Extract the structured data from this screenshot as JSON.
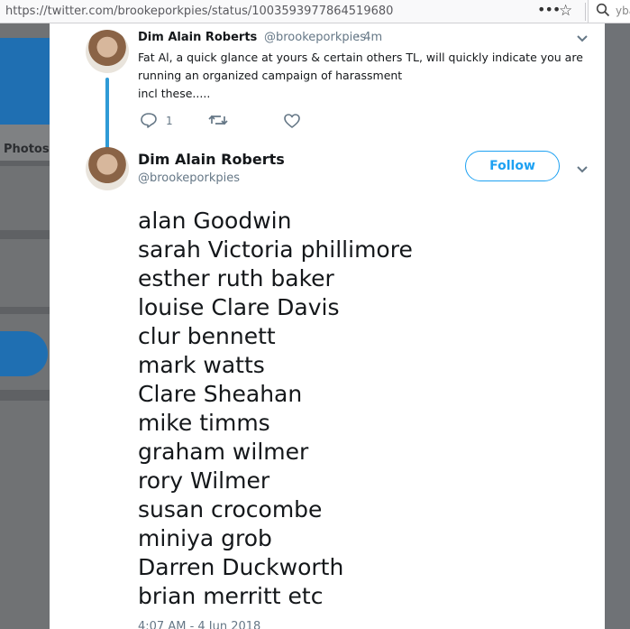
{
  "browser": {
    "url": "https://twitter.com/brookeporkpies/status/1003593977864519680",
    "menu_icon": "ellipsis-icon",
    "bookmark_icon": "star-icon",
    "search_text": "yba"
  },
  "background": {
    "tab_label": "Photos"
  },
  "reply_tweet": {
    "name": "Dim Alain Roberts",
    "handle": "@brookeporkpies",
    "time": "· 4m",
    "text_line1": "Fat Al, a quick glance at yours & certain others TL, will quickly indicate you are",
    "text_line2": "running an organized campaign of harassment",
    "text_line3": "incl these.....",
    "reply_count": "1"
  },
  "main_tweet": {
    "name": "Dim Alain Roberts",
    "handle": "@brookeporkpies",
    "follow_label": "Follow",
    "names": [
      "alan Goodwin",
      "sarah Victoria phillimore",
      "esther ruth baker",
      "louise Clare Davis",
      "clur bennett",
      "mark watts",
      "Clare Sheahan",
      "mike timms",
      "graham wilmer",
      "rory Wilmer",
      "susan crocombe",
      "miniya grob",
      "Darren Duckworth",
      "brian merritt etc"
    ],
    "timestamp": "4:07 AM - 4 Jun 2018"
  },
  "colors": {
    "accent": "#1da1f2",
    "thread_line": "#2f9bd6",
    "muted": "#657786",
    "text": "#14171a",
    "overlay": "#6f7276"
  }
}
